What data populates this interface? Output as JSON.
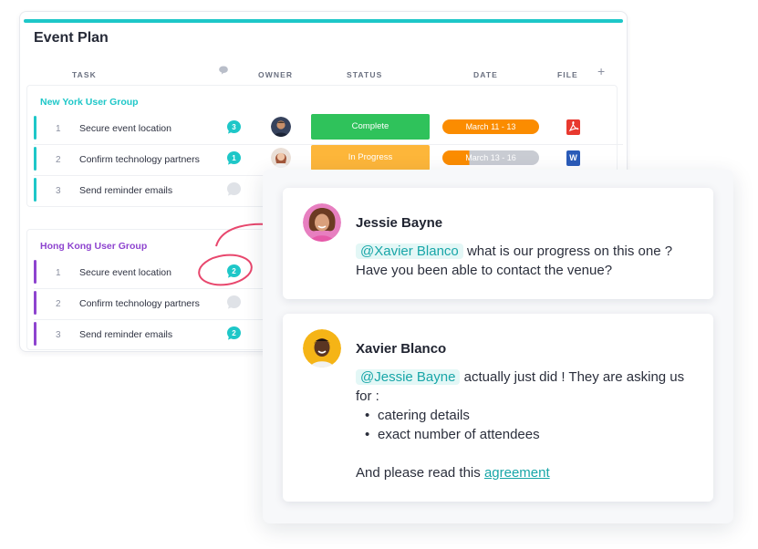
{
  "board": {
    "title": "Event Plan",
    "columns": {
      "task": "TASK",
      "owner": "OWNER",
      "status": "STATUS",
      "date": "DATE",
      "file": "FILE"
    },
    "add_column_icon": "plus-icon",
    "groups": [
      {
        "label": "New York User Group",
        "color": "#1ec7c8",
        "rows": [
          {
            "num": "1",
            "task": "Secure event location",
            "comments": "3",
            "owner": "avatar-man",
            "status": "Complete",
            "status_color": "#2fc25b",
            "date": "March 11 - 13",
            "date_color": "#fb8c00",
            "file": "PDF",
            "file_icon": "pdf-icon"
          },
          {
            "num": "2",
            "task": "Confirm technology partners",
            "comments": "1",
            "owner": "avatar-woman",
            "status": "In Progress",
            "status_color": "#fdb63a",
            "date": "March 13 - 16",
            "date_color": "#fb8c00",
            "file": "W",
            "file_icon": "word-icon"
          },
          {
            "num": "3",
            "task": "Send reminder emails",
            "comments": "",
            "owner": "",
            "status": "",
            "date": "",
            "file": ""
          }
        ]
      },
      {
        "label": "Hong Kong User Group",
        "color": "#8e44cf",
        "rows": [
          {
            "num": "1",
            "task": "Secure event location",
            "comments": "2"
          },
          {
            "num": "2",
            "task": "Confirm technology partners",
            "comments": ""
          },
          {
            "num": "3",
            "task": "Send reminder emails",
            "comments": "2"
          }
        ]
      }
    ]
  },
  "chat": {
    "messages": [
      {
        "author": "Jessie Bayne",
        "mention": "@Xavier Blanco",
        "text": " what is our progress on this one ? Have you been able to contact the venue?"
      },
      {
        "author": "Xavier Blanco",
        "mention": "@Jessie Bayne",
        "text": " actually just did ! They are asking us for :",
        "bullets": [
          "catering details",
          "exact number of attendees"
        ],
        "closing": "And please read this ",
        "link": "agreement"
      }
    ]
  },
  "colors": {
    "accent": "#1ec7c8",
    "purple": "#8e44cf",
    "annotation": "#e8476d"
  }
}
